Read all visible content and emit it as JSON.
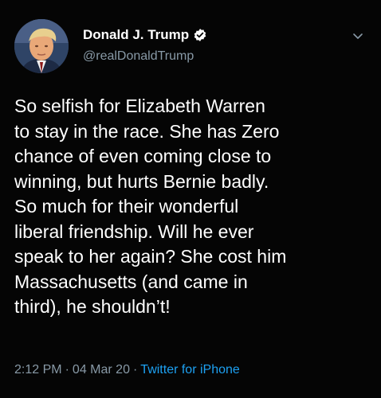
{
  "author": {
    "display_name": "Donald J. Trump",
    "handle": "@realDonaldTrump",
    "verified": true
  },
  "tweet": {
    "lines": [
      "So selfish for Elizabeth Warren",
      "to stay in the race. She has Zero",
      "chance of even coming close to",
      "winning, but hurts Bernie badly.",
      "So much for their wonderful",
      "liberal friendship. Will he ever",
      "speak to her again? She cost him",
      "Massachusetts (and came in",
      "third), he shouldn’t!"
    ]
  },
  "meta": {
    "time": "2:12 PM",
    "separator": "·",
    "date": "04 Mar 20",
    "source": "Twitter for iPhone"
  },
  "icons": {
    "verified": "verified-badge-icon",
    "more": "chevron-down-icon"
  },
  "colors": {
    "background": "#000000",
    "text": "#ffffff",
    "secondary": "#8899a6",
    "link": "#1da1f2"
  }
}
